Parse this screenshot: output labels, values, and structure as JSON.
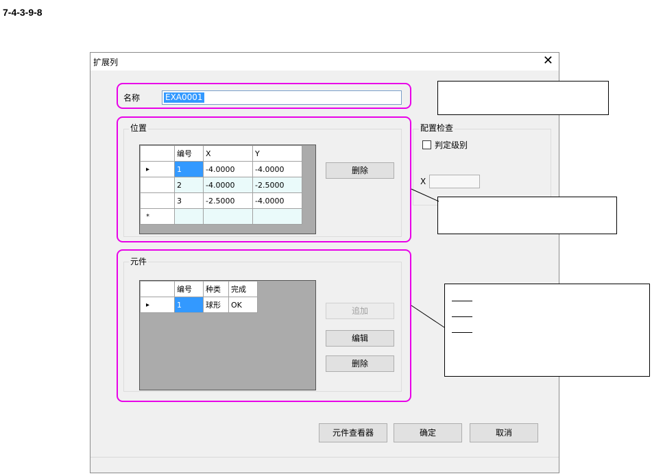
{
  "figure_label": "7-4-3-9-8",
  "dialog": {
    "title": "扩展列",
    "close_glyph": "✕",
    "name_label": "名称",
    "name_value": "EXA0001",
    "position_group": "位置",
    "position_grid": {
      "headers": [
        "编号",
        "X",
        "Y"
      ],
      "rows": [
        {
          "marker": "▸",
          "no": "1",
          "x": "-4.0000",
          "y": "-4.0000"
        },
        {
          "marker": "",
          "no": "2",
          "x": "-4.0000",
          "y": "-2.5000"
        },
        {
          "marker": "",
          "no": "3",
          "x": "-2.5000",
          "y": "-4.0000"
        }
      ],
      "new_row_marker": "*"
    },
    "position_delete": "删除",
    "layout_check_group": "配置检查",
    "judge_level_label": "判定级别",
    "judge_level_checked": false,
    "x_label": "X",
    "x_value": "",
    "element_group": "元件",
    "element_grid": {
      "headers": [
        "编号",
        "种类",
        "完成"
      ],
      "rows": [
        {
          "marker": "▸",
          "no": "1",
          "kind": "球形",
          "done": "OK"
        }
      ]
    },
    "element_add": "追加",
    "element_edit": "编辑",
    "element_delete": "删除",
    "footer": {
      "viewer": "元件查看器",
      "ok": "确定",
      "cancel": "取消"
    }
  },
  "annotation_color": "#e800e8"
}
